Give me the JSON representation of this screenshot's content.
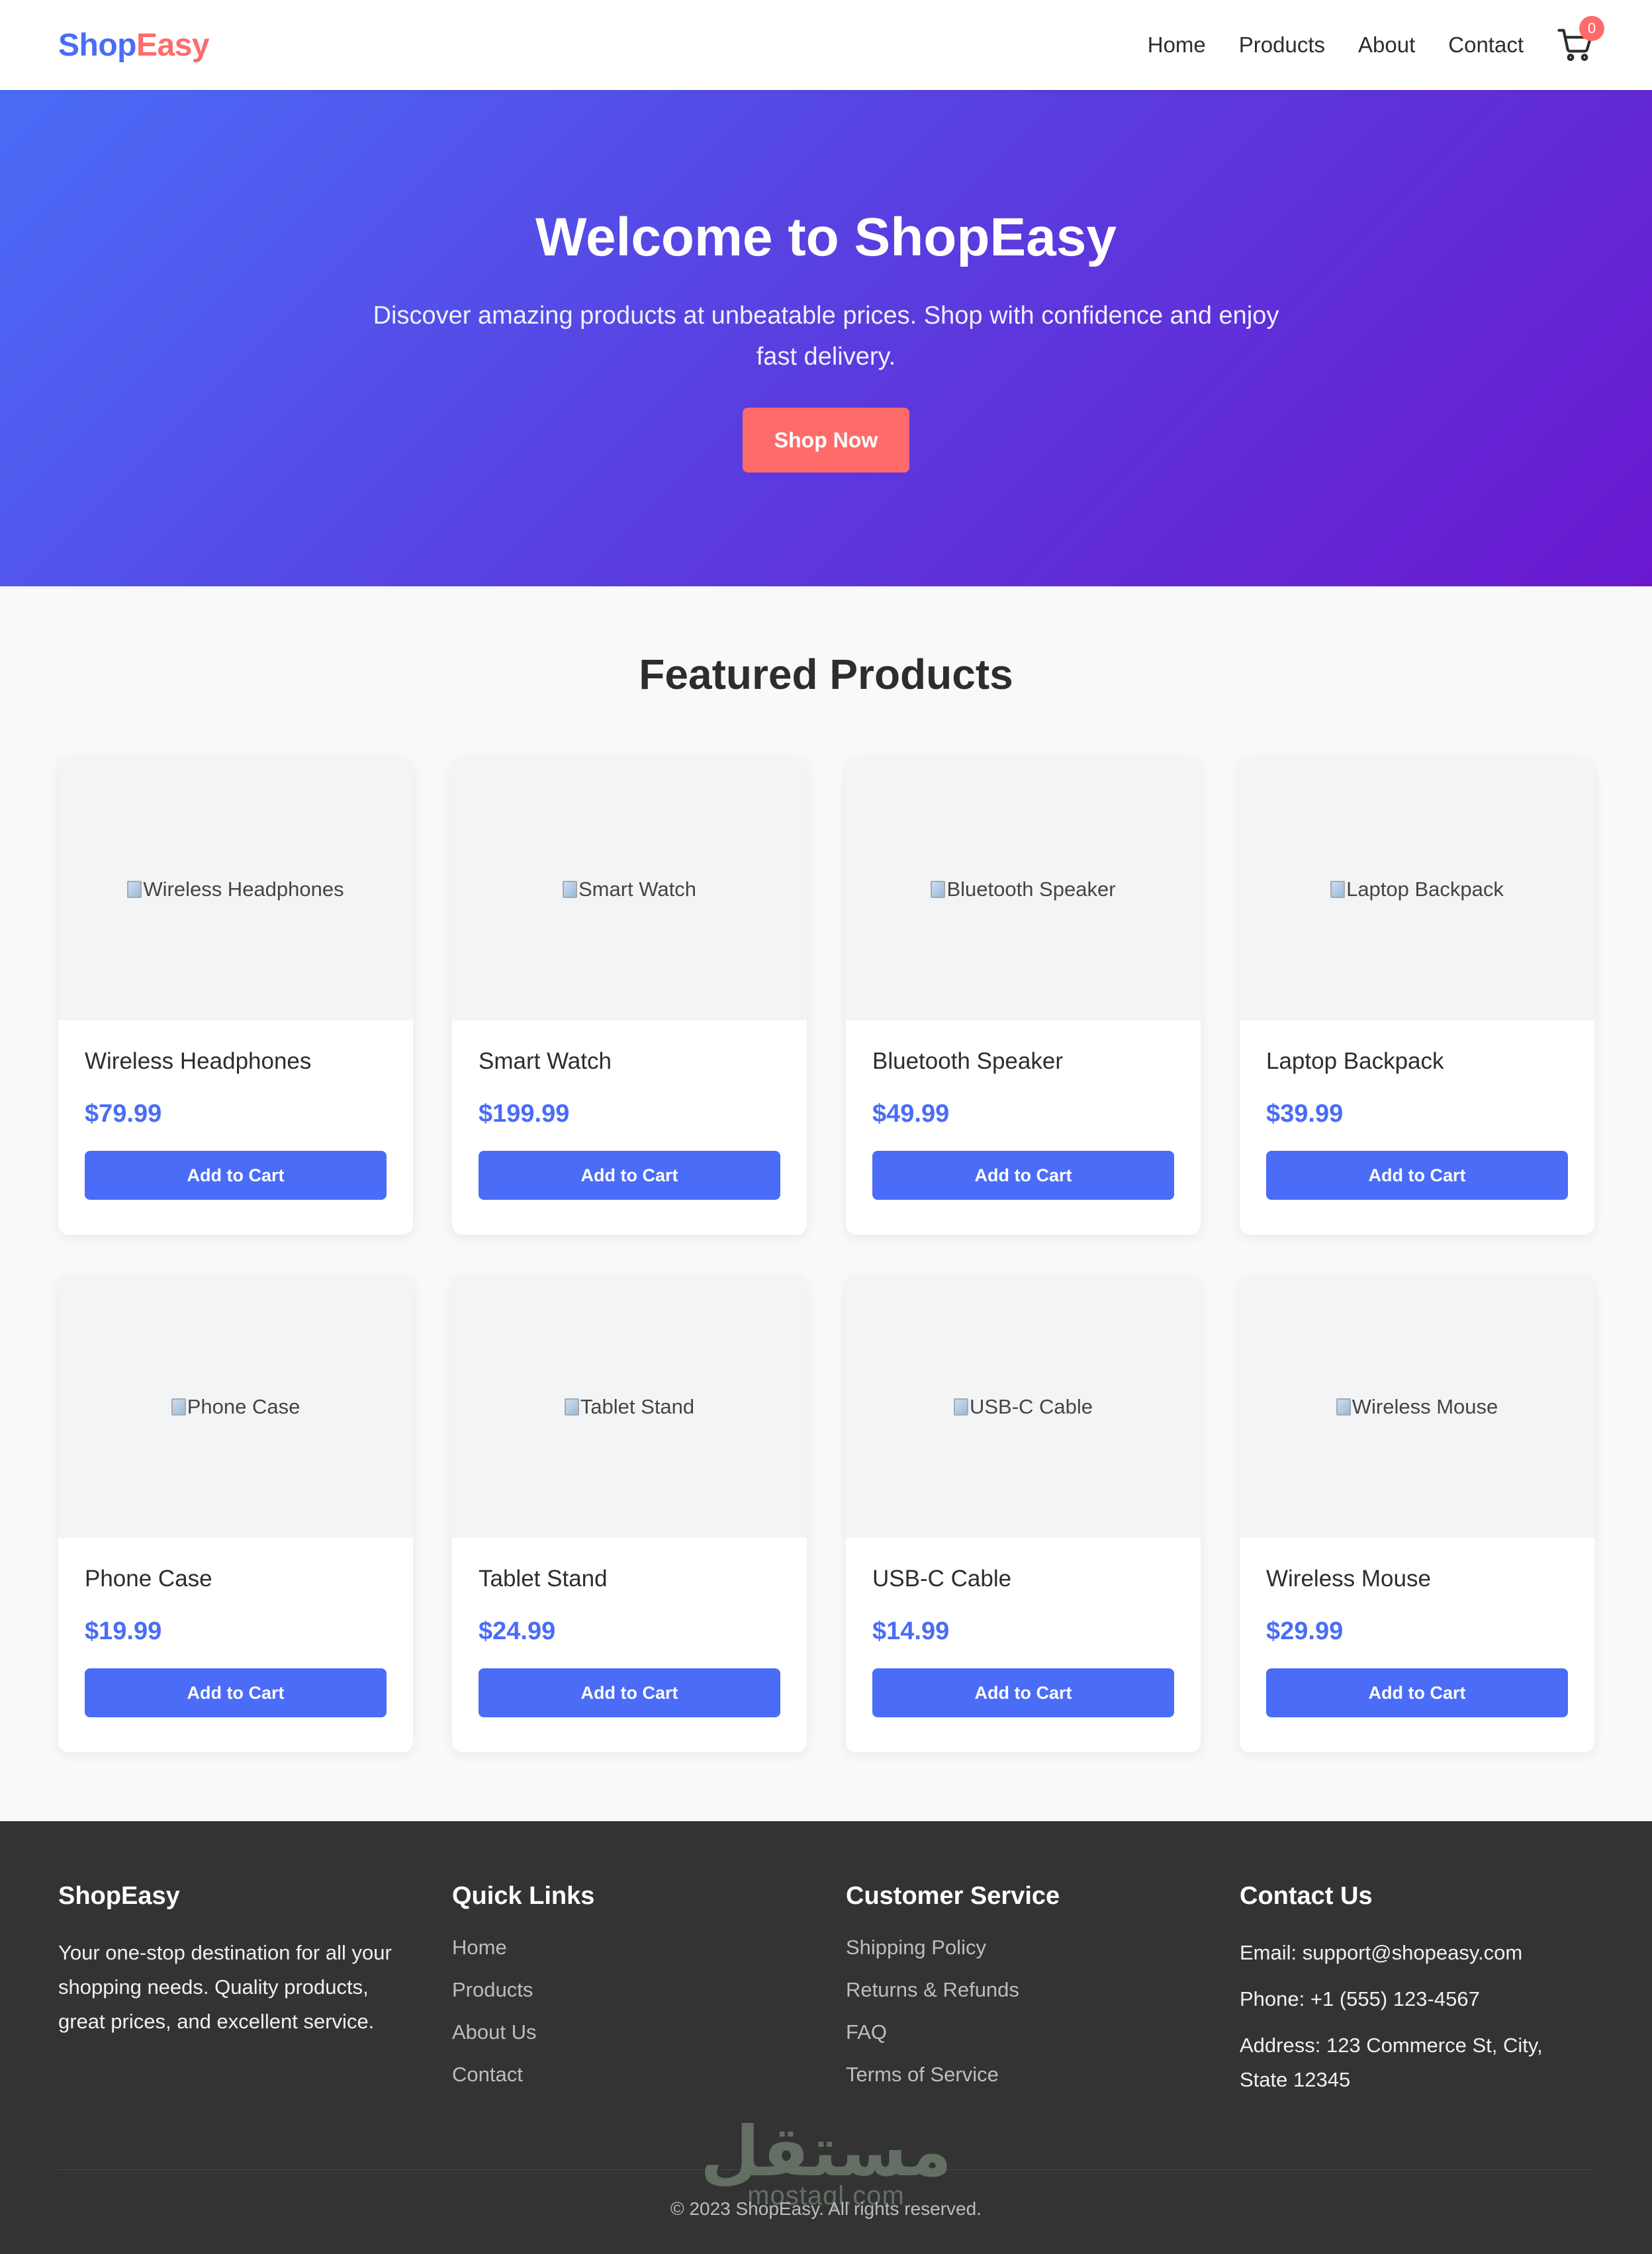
{
  "header": {
    "logo_part1": "Shop",
    "logo_part2": "Easy",
    "nav": [
      {
        "label": "Home"
      },
      {
        "label": "Products"
      },
      {
        "label": "About"
      },
      {
        "label": "Contact"
      }
    ],
    "cart_count": "0",
    "cart_icon": "shopping-cart-icon"
  },
  "hero": {
    "title": "Welcome to ShopEasy",
    "subtitle": "Discover amazing products at unbeatable prices. Shop with confidence and enjoy fast delivery.",
    "button": "Shop Now"
  },
  "products": {
    "heading": "Featured Products",
    "items": [
      {
        "alt": "Wireless Headphones",
        "name": "Wireless Headphones",
        "price": "$79.99",
        "button": "Add to Cart"
      },
      {
        "alt": "Smart Watch",
        "name": "Smart Watch",
        "price": "$199.99",
        "button": "Add to Cart"
      },
      {
        "alt": "Bluetooth Speaker",
        "name": "Bluetooth Speaker",
        "price": "$49.99",
        "button": "Add to Cart"
      },
      {
        "alt": "Laptop Backpack",
        "name": "Laptop Backpack",
        "price": "$39.99",
        "button": "Add to Cart"
      },
      {
        "alt": "Phone Case",
        "name": "Phone Case",
        "price": "$19.99",
        "button": "Add to Cart"
      },
      {
        "alt": "Tablet Stand",
        "name": "Tablet Stand",
        "price": "$24.99",
        "button": "Add to Cart"
      },
      {
        "alt": "USB-C Cable",
        "name": "USB-C Cable",
        "price": "$14.99",
        "button": "Add to Cart"
      },
      {
        "alt": "Wireless Mouse",
        "name": "Wireless Mouse",
        "price": "$29.99",
        "button": "Add to Cart"
      }
    ]
  },
  "footer": {
    "about": {
      "title": "ShopEasy",
      "text": "Your one-stop destination for all your shopping needs. Quality products, great prices, and excellent service."
    },
    "quick_links": {
      "title": "Quick Links",
      "items": [
        "Home",
        "Products",
        "About Us",
        "Contact"
      ]
    },
    "customer_service": {
      "title": "Customer Service",
      "items": [
        "Shipping Policy",
        "Returns & Refunds",
        "FAQ",
        "Terms of Service"
      ]
    },
    "contact": {
      "title": "Contact Us",
      "email": "Email: support@shopeasy.com",
      "phone": "Phone: +1 (555) 123-4567",
      "address": "Address: 123 Commerce St, City, State 12345"
    },
    "copyright": "© 2023 ShopEasy. All rights reserved."
  },
  "watermark": {
    "arabic": "مستقل",
    "latin": "mostaql.com"
  },
  "colors": {
    "primary": "#4a6cf7",
    "accent": "#ff6b6b",
    "hero_gradient_end": "#6a18cf",
    "footer_bg": "#333333"
  }
}
